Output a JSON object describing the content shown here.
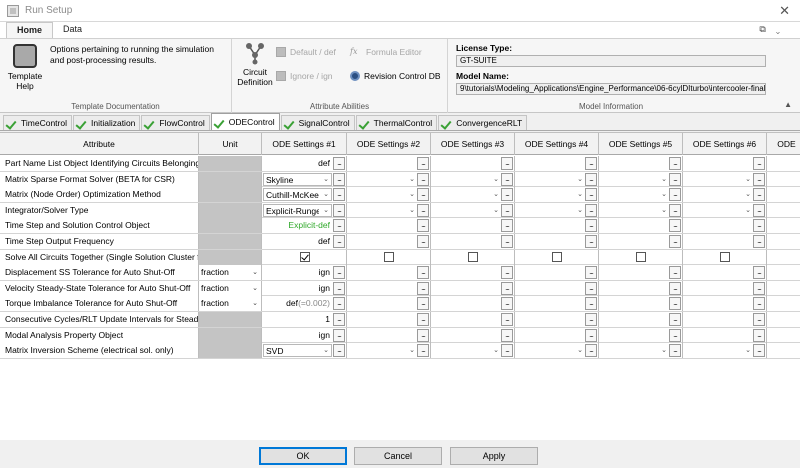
{
  "window": {
    "title": "Run Setup",
    "close_glyph": "✕"
  },
  "ribbon_tabs": [
    "Home",
    "Data"
  ],
  "ribbon_controls": [
    "⧉",
    "⌄"
  ],
  "ribbon": {
    "template_doc": {
      "button_label": "Template Help",
      "description": "Options pertaining to running the simulation and post-processing results.",
      "group_title": "Template Documentation"
    },
    "attribute_abilities": {
      "circuit_def_label": "Circuit Definition",
      "default_def": "Default / def",
      "ignore_ign": "Ignore / ign",
      "formula_editor": "Formula Editor",
      "revision_control": "Revision Control DB",
      "group_title": "Attribute Abilities"
    },
    "model_info": {
      "license_label": "License Type:",
      "license_value": "GT-SUITE",
      "model_label": "Model Name:",
      "model_value": "9\\tutorials\\Modeling_Applications\\Engine_Performance\\06-6cylDIturbo\\intercooler-final.gtm",
      "group_title": "Model Information"
    }
  },
  "folder_tabs": [
    "TimeControl",
    "Initialization",
    "FlowControl",
    "ODEControl",
    "SignalControl",
    "ThermalControl",
    "ConvergenceRLT"
  ],
  "active_folder_tab": "ODEControl",
  "grid": {
    "headers": [
      "Attribute",
      "Unit",
      "ODE Settings #1",
      "ODE Settings #2",
      "ODE Settings #3",
      "ODE Settings #4",
      "ODE Settings #5",
      "ODE Settings #6",
      "ODE"
    ],
    "rows": [
      {
        "attribute": "Part Name List Object Identifying Circuits Belonging to ...",
        "unit": "",
        "value": "def",
        "kind": "text"
      },
      {
        "attribute": "Matrix Sparse Format Solver (BETA for CSR)",
        "unit": "",
        "value": "Skyline",
        "kind": "dropdown"
      },
      {
        "attribute": "Matrix (Node Order) Optimization Method",
        "unit": "",
        "value": "Cuthill-McKee",
        "kind": "dropdown"
      },
      {
        "attribute": "Integrator/Solver Type",
        "unit": "",
        "value": "Explicit-Runge-Ku...",
        "kind": "dropdown"
      },
      {
        "attribute": "Time Step and Solution Control Object",
        "unit": "",
        "value": "Explicit-def",
        "kind": "green"
      },
      {
        "attribute": "Time Step Output Frequency",
        "unit": "",
        "value": "def",
        "kind": "text"
      },
      {
        "attribute": "Solve All Circuits Together (Single Solution Cluster for t...",
        "unit": "",
        "value": "",
        "kind": "checkbox"
      },
      {
        "attribute": "Displacement SS Tolerance for Auto Shut-Off",
        "unit": "fraction",
        "value": "ign",
        "kind": "text"
      },
      {
        "attribute": "Velocity Steady-State Tolerance for Auto Shut-Off",
        "unit": "fraction",
        "value": "ign",
        "kind": "text"
      },
      {
        "attribute": "Torque Imbalance Tolerance for Auto Shut-Off",
        "unit": "fraction",
        "value": "def",
        "value_note": "(=0.002)",
        "kind": "text"
      },
      {
        "attribute": "Consecutive Cycles/RLT Update Intervals for Steady-...",
        "unit": "",
        "value": "1",
        "kind": "text"
      },
      {
        "attribute": "Modal Analysis Property Object",
        "unit": "",
        "value": "ign",
        "kind": "text"
      },
      {
        "attribute": "Matrix Inversion Scheme (electrical sol. only)",
        "unit": "",
        "value": "SVD",
        "kind": "dropdown"
      }
    ],
    "ellipsis": "..."
  },
  "buttons": {
    "ok": "OK",
    "cancel": "Cancel",
    "apply": "Apply"
  }
}
